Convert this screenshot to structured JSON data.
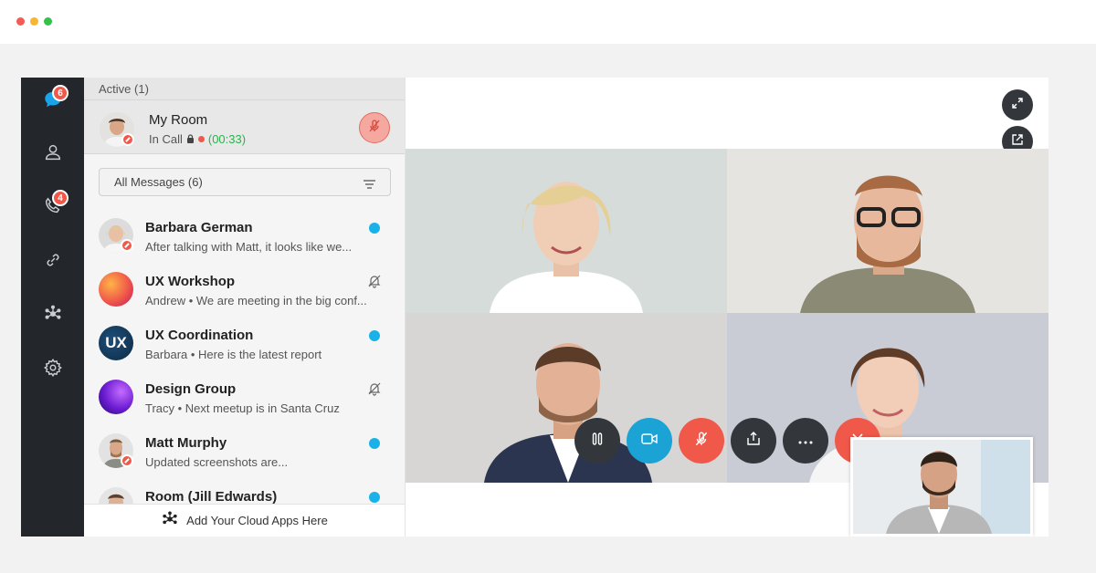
{
  "colors": {
    "rail_bg": "#23272b",
    "badge": "#f0584a",
    "unread": "#18b2e8",
    "timer": "#2bb24c",
    "video_btn": "#1aa3d4",
    "hangup": "#f0584a"
  },
  "rail": {
    "items": [
      {
        "icon": "chat-icon",
        "badge": "6"
      },
      {
        "icon": "contacts-icon",
        "badge": ""
      },
      {
        "icon": "phone-icon",
        "badge": "4"
      },
      {
        "icon": "link-icon",
        "badge": ""
      },
      {
        "icon": "apps-hub-icon",
        "badge": ""
      },
      {
        "icon": "settings-icon",
        "badge": ""
      }
    ]
  },
  "active": {
    "header": "Active (1)",
    "room_name": "My Room",
    "status": "In Call",
    "timer": "(00:33)"
  },
  "filter": {
    "label": "All Messages (6)"
  },
  "conversations": [
    {
      "name": "Barbara German",
      "preview": "After talking with Matt, it looks like we...",
      "unread": true,
      "muted": false
    },
    {
      "name": "UX Workshop",
      "preview": "Andrew • We are meeting in the big conf...",
      "unread": false,
      "muted": true
    },
    {
      "name": "UX Coordination",
      "preview": "Barbara • Here is the latest report",
      "unread": true,
      "muted": false,
      "avatar_text": "UX"
    },
    {
      "name": "Design Group",
      "preview": "Tracy • Next meetup is in Santa Cruz",
      "unread": false,
      "muted": true
    },
    {
      "name": "Matt Murphy",
      "preview": "Updated screenshots are...",
      "unread": true,
      "muted": false
    },
    {
      "name": "Room (Jill Edwards)",
      "preview": "",
      "unread": true,
      "muted": false
    }
  ],
  "footer": {
    "label": "Add Your Cloud Apps Here"
  },
  "call_controls": [
    "pause-icon",
    "video-camera-icon",
    "mic-muted-icon",
    "share-screen-icon",
    "more-icon",
    "hang-up-icon"
  ]
}
